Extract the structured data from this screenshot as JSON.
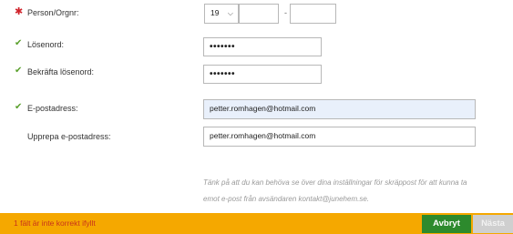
{
  "fields": {
    "person": {
      "label": "Person/Orgnr:",
      "century": "19",
      "separator": "-",
      "icon": "required-asterisk-icon"
    },
    "password": {
      "label": "Lösenord:",
      "value": "•••••••",
      "icon": "check-icon"
    },
    "confirm_password": {
      "label": "Bekräfta lösenord:",
      "value": "•••••••",
      "icon": "check-icon"
    },
    "email": {
      "label": "E-postadress:",
      "value": "petter.romhagen@hotmail.com",
      "icon": "check-icon"
    },
    "repeat_email": {
      "label": "Upprepa e-postadress:",
      "value": "petter.romhagen@hotmail.com"
    }
  },
  "hint": {
    "line1": "Tänk på att du kan behöva se över dina inställningar för skräppost för att kunna ta",
    "line2": "emot e-post från avsändaren kontakt@junehem.se."
  },
  "footer": {
    "error_message": "1 fält är inte korrekt ifyllt",
    "cancel_label": "Avbryt",
    "next_label": "Nästa"
  },
  "colors": {
    "footer_bg": "#f5a800",
    "error_text": "#c8341b",
    "cancel_bg": "#2d8a2d",
    "next_disabled_bg": "#cfcfcf",
    "check": "#5aa02c",
    "required": "#d0232b"
  }
}
